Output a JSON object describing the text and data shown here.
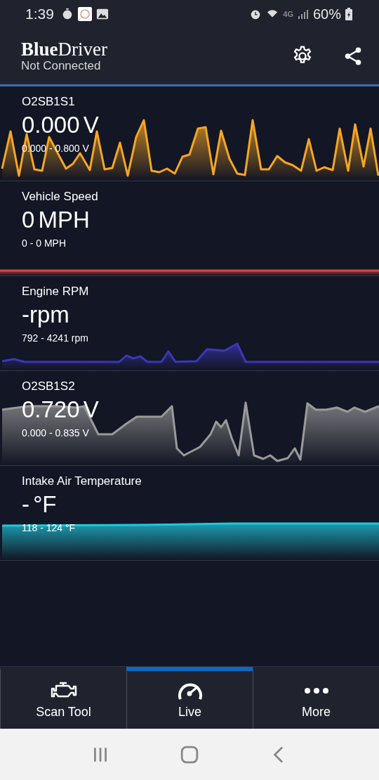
{
  "status_bar": {
    "time": "1:39",
    "network": "4G",
    "battery": "60%"
  },
  "app_bar": {
    "title_bold": "Blue",
    "title_light": "Driver",
    "subtitle": "Not Connected"
  },
  "gauges": [
    {
      "label": "O2SB1S1",
      "value": "0.000 V",
      "range": "0.000 - 0.800 V",
      "color": "#f5a623"
    },
    {
      "label": "Vehicle Speed",
      "value": "0 MPH",
      "range": "0 - 0 MPH",
      "color": "#d9443a"
    },
    {
      "label": "Engine RPM",
      "value": "-rpm",
      "range": "792 - 4241 rpm",
      "color": "#3b37b8"
    },
    {
      "label": "O2SB1S2",
      "value": "0.720 V",
      "range": "0.000 - 0.835 V",
      "color": "#9a9a9a"
    },
    {
      "label": "Intake Air Temperature",
      "value": "- °F",
      "range": "118 - 124 °F",
      "color": "#1ec8dc"
    }
  ],
  "tabs": [
    {
      "label": "Scan Tool",
      "selected": false
    },
    {
      "label": "Live",
      "selected": true
    },
    {
      "label": "More",
      "selected": false
    }
  ]
}
